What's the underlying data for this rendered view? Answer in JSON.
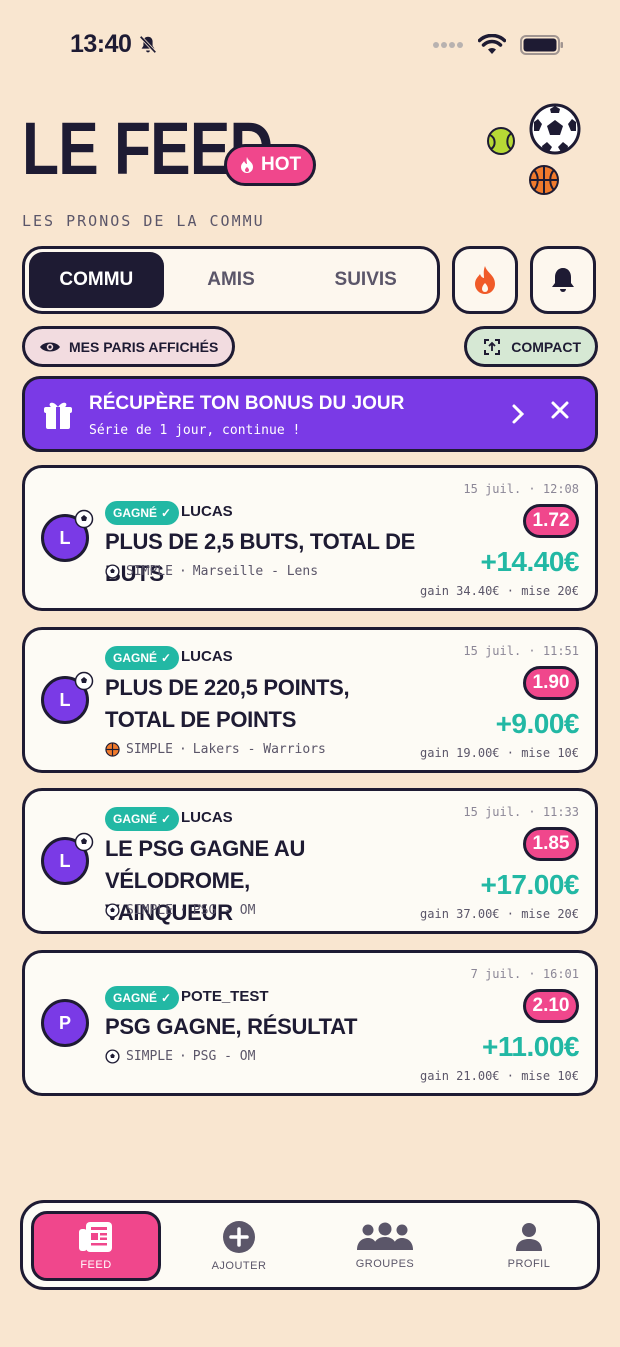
{
  "status_bar": {
    "time": "13:40"
  },
  "header": {
    "title": "LE FEED",
    "hot_label": "HOT",
    "subtitle": "LES PRONOS DE LA COMMU"
  },
  "tabs": [
    {
      "label": "COMMU",
      "active": true
    },
    {
      "label": "AMIS",
      "active": false
    },
    {
      "label": "SUIVIS",
      "active": false
    }
  ],
  "filters": {
    "my_bets_label": "MES PARIS AFFICHÉS",
    "compact_label": "COMPACT"
  },
  "bonus": {
    "title": "RÉCUPÈRE TON BONUS DU JOUR",
    "subtitle": "Série de 1 jour, continue !"
  },
  "bets": [
    {
      "avatar": "L",
      "status": "GAGNÉ",
      "user": "LUCAS",
      "title": "PLUS DE 2,5 BUTS, TOTAL DE BUTS",
      "type": "SIMPLE",
      "match": "Marseille - Lens",
      "sport": "football",
      "date": "15 juil. · 12:08",
      "odds": "1.72",
      "gain": "+14.40€",
      "footer": "gain 34.40€ · mise 20€"
    },
    {
      "avatar": "L",
      "status": "GAGNÉ",
      "user": "LUCAS",
      "title": "PLUS DE 220,5 POINTS, TOTAL DE POINTS",
      "type": "SIMPLE",
      "match": "Lakers - Warriors",
      "sport": "basketball",
      "date": "15 juil. · 11:51",
      "odds": "1.90",
      "gain": "+9.00€",
      "footer": "gain 19.00€ · mise 10€"
    },
    {
      "avatar": "L",
      "status": "GAGNÉ",
      "user": "LUCAS",
      "title": "LE PSG GAGNE AU VÉLODROME, VAINQUEUR",
      "type": "SIMPLE",
      "match": "PSG - OM",
      "sport": "football",
      "date": "15 juil. · 11:33",
      "odds": "1.85",
      "gain": "+17.00€",
      "footer": "gain 37.00€ · mise 20€"
    },
    {
      "avatar": "P",
      "status": "GAGNÉ",
      "user": "POTE_TEST",
      "title": "PSG GAGNE, RÉSULTAT",
      "type": "SIMPLE",
      "match": "PSG - OM",
      "sport": "football",
      "date": "7 juil. · 16:01",
      "odds": "2.10",
      "gain": "+11.00€",
      "footer": "gain 21.00€ · mise 10€"
    }
  ],
  "nav": [
    {
      "label": "FEED",
      "icon": "feed-icon",
      "active": true
    },
    {
      "label": "AJOUTER",
      "icon": "add-icon",
      "active": false
    },
    {
      "label": "GROUPES",
      "icon": "groups-icon",
      "active": false
    },
    {
      "label": "PROFIL",
      "icon": "profile-icon",
      "active": false
    }
  ],
  "colors": {
    "background": "#f9e6d0",
    "ink": "#1e1b33",
    "pink": "#f0478c",
    "purple": "#7a3ae6",
    "teal": "#22b8a4"
  }
}
